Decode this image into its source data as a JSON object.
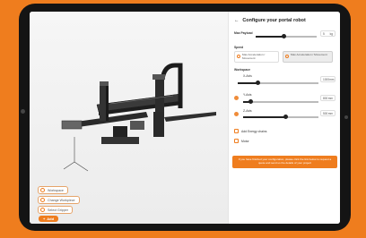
{
  "viewer": {
    "buttons": [
      {
        "label": "Workspace",
        "icon": "cube-icon"
      },
      {
        "label": "Change Workpiece",
        "icon": "box-icon"
      },
      {
        "label": "Select Gripper",
        "icon": "gripper-icon"
      }
    ],
    "add_label": "Add"
  },
  "panel": {
    "back_icon": "arrow-left-icon",
    "title": "Configure your portal robot",
    "max_payload": {
      "label": "Max Payload",
      "value": "5",
      "unit": "kg",
      "fraction": 0.45
    },
    "speed": {
      "label": "Speed",
      "options": [
        {
          "label": "Max Acceleration / Movement",
          "selected": false
        },
        {
          "label": "Max Acceleration / Movement",
          "selected": true
        }
      ]
    },
    "workspace": {
      "label": "Workspace",
      "axes": [
        {
          "label": "X-Axis",
          "value": "1000",
          "unit": "mm",
          "fraction": 0.25
        },
        {
          "label": "Y-Axis",
          "value": "800",
          "unit": "mm",
          "fraction": 0.1
        },
        {
          "label": "Z-Axis",
          "value": "500",
          "unit": "mm",
          "fraction": 0.55
        }
      ]
    },
    "checks": [
      {
        "label": "Add Energy chains"
      },
      {
        "label": "Motor"
      }
    ],
    "banner": "If you have finished your configuration, please click the link below to request a quote and send us the details of your project"
  },
  "colors": {
    "accent": "#ef7d1e",
    "frame": "#141414"
  }
}
